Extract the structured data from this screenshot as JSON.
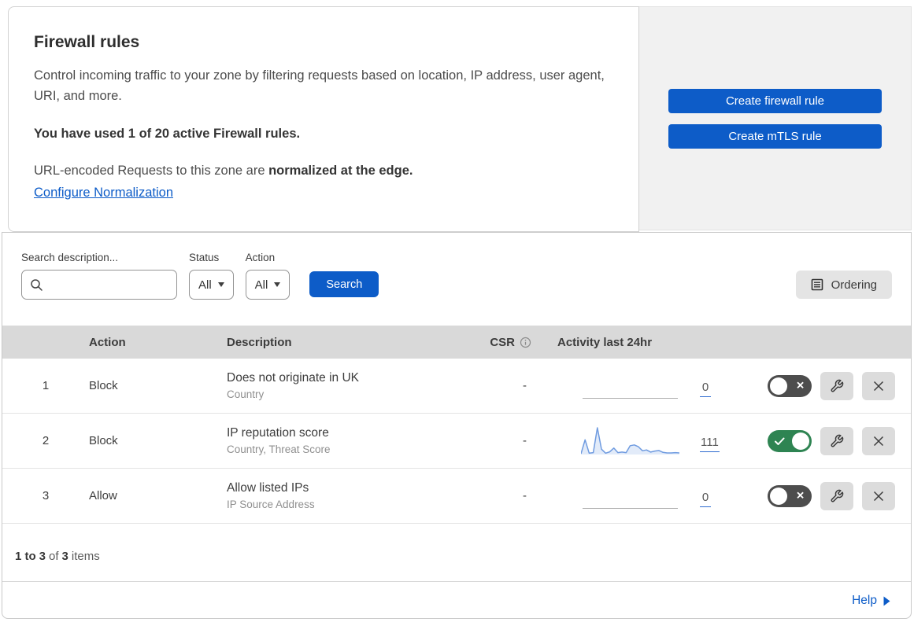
{
  "intro": {
    "title": "Firewall rules",
    "description": "Control incoming traffic to your zone by filtering requests based on location, IP address, user agent, URI, and more.",
    "usage": "You have used 1 of 20 active Firewall rules.",
    "normalization_prefix": "URL-encoded Requests to this zone are ",
    "normalization_bold": "normalized at the edge.",
    "link": "Configure Normalization"
  },
  "actions": {
    "create_firewall": "Create firewall rule",
    "create_mtls": "Create mTLS rule"
  },
  "filters": {
    "search_label": "Search description...",
    "status_label": "Status",
    "status_value": "All",
    "action_label": "Action",
    "action_value": "All",
    "search_button": "Search",
    "ordering_button": "Ordering"
  },
  "table": {
    "headers": {
      "action": "Action",
      "description": "Description",
      "csr": "CSR",
      "activity": "Activity last 24hr"
    },
    "rows": [
      {
        "num": "1",
        "action": "Block",
        "description": "Does not originate in UK",
        "expression_fields": "Country",
        "csr": "-",
        "activity_count": "0",
        "enabled": false,
        "sparkline": []
      },
      {
        "num": "2",
        "action": "Block",
        "description": "IP reputation score",
        "expression_fields": "Country, Threat Score",
        "csr": "-",
        "activity_count": "111",
        "enabled": true,
        "sparkline": [
          3,
          55,
          5,
          7,
          100,
          20,
          5,
          10,
          24,
          7,
          9,
          7,
          33,
          36,
          29,
          14,
          17,
          9,
          13,
          15,
          8,
          6,
          6,
          7,
          6
        ]
      },
      {
        "num": "3",
        "action": "Allow",
        "description": "Allow listed IPs",
        "expression_fields": "IP Source Address",
        "csr": "-",
        "activity_count": "0",
        "enabled": false,
        "sparkline": []
      }
    ]
  },
  "footer": {
    "bold_start": "1 to",
    "bold_end": "3",
    "of": "of",
    "bold_total": "3",
    "items": "items"
  },
  "help": {
    "label": "Help"
  },
  "colors": {
    "accent_blue": "#0d5cc8",
    "toggle_on_green": "#2e8452",
    "toggle_off_gray": "#4d4d4d",
    "spark_stroke": "#6f9be0",
    "spark_fill": "#e2ebf9",
    "table_header_bg": "#d9d9d9",
    "side_panel_bg": "#f1f1f1"
  }
}
